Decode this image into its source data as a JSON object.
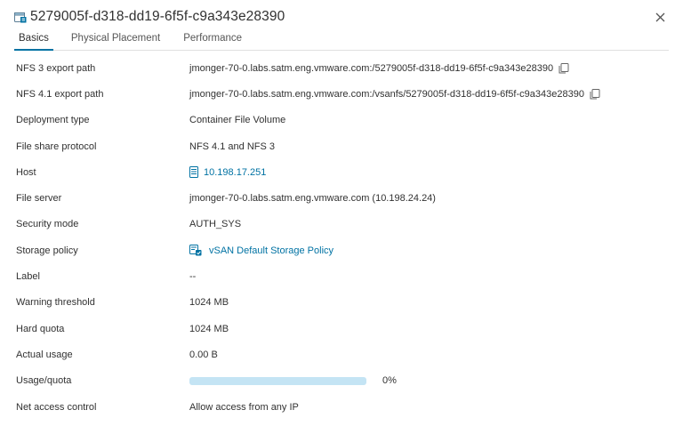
{
  "header": {
    "title": "5279005f-d318-dd19-6f5f-c9a343e28390"
  },
  "tabs": [
    {
      "label": "Basics",
      "active": true
    },
    {
      "label": "Physical Placement",
      "active": false
    },
    {
      "label": "Performance",
      "active": false
    }
  ],
  "colors": {
    "accent": "#0072a3",
    "progress_track": "#c4e4f4"
  },
  "rows": {
    "nfs3": {
      "label": "NFS 3 export path",
      "value": "jmonger-70-0.labs.satm.eng.vmware.com:/5279005f-d318-dd19-6f5f-c9a343e28390"
    },
    "nfs41": {
      "label": "NFS 4.1 export path",
      "value": "jmonger-70-0.labs.satm.eng.vmware.com:/vsanfs/5279005f-d318-dd19-6f5f-c9a343e28390"
    },
    "deployment": {
      "label": "Deployment type",
      "value": "Container File Volume"
    },
    "protocol": {
      "label": "File share protocol",
      "value": "NFS 4.1 and NFS 3"
    },
    "host": {
      "label": "Host",
      "value": "10.198.17.251",
      "icon": "host-icon"
    },
    "file_server": {
      "label": "File server",
      "value": "jmonger-70-0.labs.satm.eng.vmware.com (10.198.24.24)"
    },
    "security": {
      "label": "Security mode",
      "value": "AUTH_SYS"
    },
    "policy": {
      "label": "Storage policy",
      "value": "vSAN Default Storage Policy",
      "icon": "storage-policy-icon"
    },
    "label": {
      "label": "Label",
      "value": "--"
    },
    "warning": {
      "label": "Warning threshold",
      "value": "1024 MB"
    },
    "quota": {
      "label": "Hard quota",
      "value": "1024 MB"
    },
    "usage": {
      "label": "Actual usage",
      "value": "0.00 B"
    },
    "usage_quota": {
      "label": "Usage/quota",
      "percent": 0,
      "percent_text": "0%"
    },
    "access": {
      "label": "Net access control",
      "value": "Allow access from any IP"
    }
  }
}
